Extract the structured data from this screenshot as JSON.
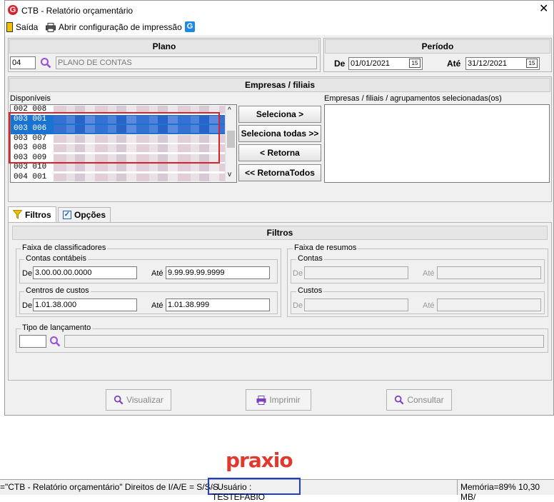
{
  "window": {
    "title": "CTB - Relatório orçamentário",
    "app_icon": "G",
    "close_glyph": "✕"
  },
  "toolbar": {
    "exit_label": "Saída",
    "print_config_label": "Abrir configuração de impressão",
    "help_icon": "G"
  },
  "plano": {
    "heading": "Plano",
    "code": "04",
    "name": "PLANO DE CONTAS"
  },
  "periodo": {
    "heading": "Período",
    "from_label": "De",
    "from_value": "01/01/2021",
    "to_label": "Até",
    "to_value": "31/12/2021",
    "calendar_glyph": "15"
  },
  "empresas": {
    "heading": "Empresas / filiais",
    "available_label": "Disponíveis",
    "selected_label": "Empresas / filiais / agrupamentos selecionadas(os)",
    "rows": [
      {
        "code": "002 008",
        "selected": false
      },
      {
        "code": "003 001",
        "selected": true
      },
      {
        "code": "003 006",
        "selected": true
      },
      {
        "code": "003 007",
        "selected": false
      },
      {
        "code": "003 008",
        "selected": false
      },
      {
        "code": "003 009",
        "selected": false
      },
      {
        "code": "003 010",
        "selected": false
      },
      {
        "code": "004 001",
        "selected": false
      }
    ],
    "btn_select": "Seleciona >",
    "btn_select_all": "Seleciona todas >>",
    "btn_return": "< Retorna",
    "btn_return_all": "<< RetornaTodos"
  },
  "tabs": {
    "filters": "Filtros",
    "options": "Opções"
  },
  "filtros": {
    "heading": "Filtros",
    "faixa_class": "Faixa de classificadores",
    "contas_contabeis": "Contas contábeis",
    "cc_from_label": "De",
    "cc_from": "3.00.00.00.0000",
    "cc_to_label": "Até",
    "cc_to": "9.99.99.99.9999",
    "centros_custos": "Centros de custos",
    "ct_from_label": "De",
    "ct_from": "1.01.38.000",
    "ct_to_label": "Até",
    "ct_to": "1.01.38.999",
    "faixa_resumos": "Faixa de resumos",
    "contas": "Contas",
    "r_contas_from_label": "De",
    "r_contas_to_label": "Até",
    "custos": "Custos",
    "r_custos_from_label": "De",
    "r_custos_to_label": "Até",
    "tipo_lancamento": "Tipo de lançamento"
  },
  "footer": {
    "visualizar": "Visualizar",
    "imprimir": "Imprimir",
    "consultar": "Consultar"
  },
  "brand": "praxio",
  "status": {
    "left": "=\"CTB - Relatório orçamentário\" Direitos de I/A/E = S/S/S.",
    "user": "- Usuário : TESTEFABIO",
    "memory": "Memória=89% 10,30 MB/"
  }
}
